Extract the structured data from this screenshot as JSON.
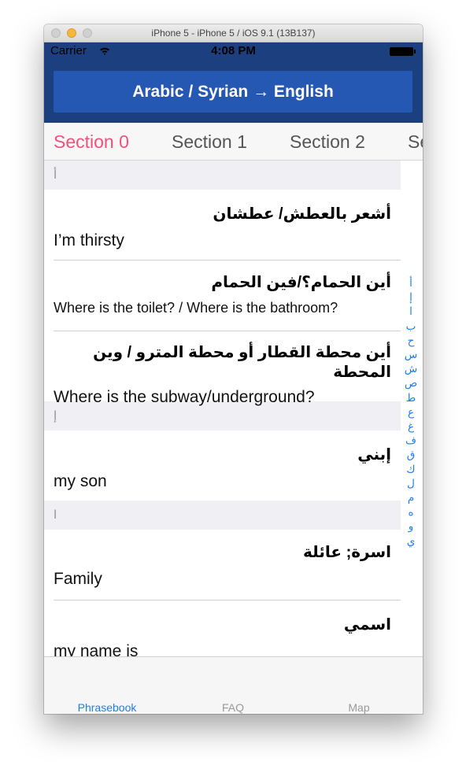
{
  "window": {
    "title": "iPhone 5 - iPhone 5 / iOS 9.1 (13B137)"
  },
  "status": {
    "carrier": "Carrier",
    "time": "4:08 PM"
  },
  "nav": {
    "title": "Arabic / Syrian → English"
  },
  "tabs": [
    "Section 0",
    "Section 1",
    "Section 2",
    "Se"
  ],
  "sections": [
    {
      "header": "أ",
      "rows": [
        {
          "ar": "أشعر بالعطش/ عطشان",
          "en": "I’m thirsty"
        },
        {
          "ar": "أين الحمام؟/فين الحمام",
          "en": "Where is the toilet? /  Where is the bathroom?"
        },
        {
          "ar": "أين محطة القطار أو محطة المترو / وين المحطة",
          "en": "Where is the subway/underground?"
        }
      ]
    },
    {
      "header": "إ",
      "rows": [
        {
          "ar": "إبني",
          "en": "my son"
        }
      ]
    },
    {
      "header": "ا",
      "rows": [
        {
          "ar": "اسرة; عائلة",
          "en": "Family"
        },
        {
          "ar": "اسمي",
          "en": "my name is"
        }
      ]
    }
  ],
  "index": [
    "أ",
    "إ",
    "ا",
    "ب",
    "ح",
    "س",
    "ش",
    "ص",
    "ط",
    "ع",
    "غ",
    "ف",
    "ق",
    "ك",
    "ل",
    "م",
    "ه",
    "و",
    "ي"
  ],
  "tabbar": [
    "Phrasebook",
    "FAQ",
    "Map"
  ]
}
